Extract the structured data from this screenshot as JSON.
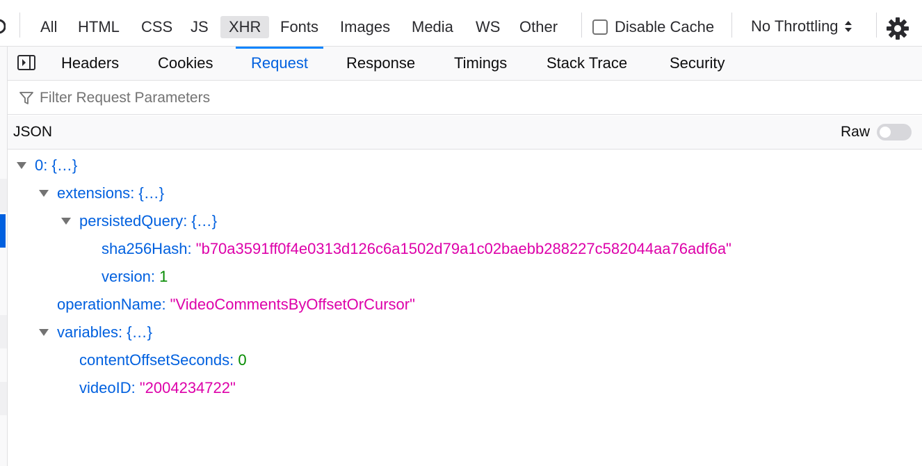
{
  "filter_types": [
    "All",
    "HTML",
    "CSS",
    "JS",
    "XHR",
    "Fonts",
    "Images",
    "Media",
    "WS",
    "Other"
  ],
  "active_filter_type": "XHR",
  "disable_cache_label": "Disable Cache",
  "throttling": "No Throttling",
  "tabs": [
    "Headers",
    "Cookies",
    "Request",
    "Response",
    "Timings",
    "Stack Trace",
    "Security"
  ],
  "active_tab": "Request",
  "filter_placeholder": "Filter Request Parameters",
  "json_label": "JSON",
  "raw_label": "Raw",
  "raw_enabled": false,
  "tree": {
    "root_key": "0",
    "root_value": "{…}",
    "extensions_key": "extensions",
    "extensions_value": "{…}",
    "persisted_key": "persistedQuery",
    "persisted_value": "{…}",
    "hash_key": "sha256Hash",
    "hash_value": "\"b70a3591ff0f4e0313d126c6a1502d79a1c02baebb288227c582044aa76adf6a\"",
    "version_key": "version",
    "version_value": "1",
    "opname_key": "operationName",
    "opname_value": "\"VideoCommentsByOffsetOrCursor\"",
    "variables_key": "variables",
    "variables_value": "{…}",
    "offset_key": "contentOffsetSeconds",
    "offset_value": "0",
    "videoid_key": "videoID",
    "videoid_value": "\"2004234722\""
  },
  "icons": {
    "panel_toggle": "sidebar-toggle-icon",
    "filter": "funnel-icon",
    "settings": "gear-icon",
    "throttle_arrows": "updown-arrows-icon"
  },
  "colors": {
    "accent": "#0060df",
    "string": "#dd00a9",
    "number": "#058b00"
  }
}
